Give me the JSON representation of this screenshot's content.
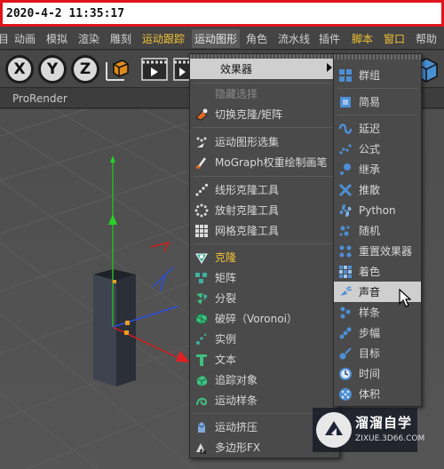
{
  "timestamp": "2020-4-2  11:35:17",
  "menubar": [
    {
      "label": "动画"
    },
    {
      "label": "模拟"
    },
    {
      "label": "渲染"
    },
    {
      "label": "雕刻"
    },
    {
      "label": "运动跟踪"
    },
    {
      "label": "运动图形"
    },
    {
      "label": "角色"
    },
    {
      "label": "流水线"
    },
    {
      "label": "插件"
    },
    {
      "label": "脚本"
    },
    {
      "label": "窗口"
    },
    {
      "label": "帮助"
    }
  ],
  "toolbar": {
    "axis_x": "X",
    "axis_y": "Y",
    "axis_z": "Z"
  },
  "viewport": {
    "title": "ProRender"
  },
  "mograph_menu": {
    "effectors_label": "效果器",
    "items": [
      {
        "label": "隐藏选择"
      },
      {
        "label": "切换克隆/矩阵"
      },
      {
        "label": "运动图形选集"
      },
      {
        "label": "MoGraph权重绘制画笔"
      },
      {
        "label": "线形克隆工具"
      },
      {
        "label": "放射克隆工具"
      },
      {
        "label": "网格克隆工具"
      },
      {
        "label": "克隆"
      },
      {
        "label": "矩阵"
      },
      {
        "label": "分裂"
      },
      {
        "label": "破碎（Voronoi）"
      },
      {
        "label": "实例"
      },
      {
        "label": "文本"
      },
      {
        "label": "追踪对象"
      },
      {
        "label": "运动样条"
      },
      {
        "label": "运动挤压"
      },
      {
        "label": "多边形FX"
      }
    ]
  },
  "effectors_menu": {
    "items": [
      {
        "label": "群组"
      },
      {
        "label": "简易"
      },
      {
        "label": "延迟"
      },
      {
        "label": "公式"
      },
      {
        "label": "继承"
      },
      {
        "label": "推散"
      },
      {
        "label": "Python"
      },
      {
        "label": "随机"
      },
      {
        "label": "重置效果器"
      },
      {
        "label": "着色"
      },
      {
        "label": "声音"
      },
      {
        "label": "样条"
      },
      {
        "label": "步幅"
      },
      {
        "label": "目标"
      },
      {
        "label": "时间"
      },
      {
        "label": "体积"
      }
    ]
  },
  "watermark": {
    "title": "溜溜自学",
    "url": "ZIXUE.3D66.COM"
  },
  "colors": {
    "highlight": "#f3c233",
    "hover": "#cfcfcf",
    "accent_red": "#e0151b"
  }
}
